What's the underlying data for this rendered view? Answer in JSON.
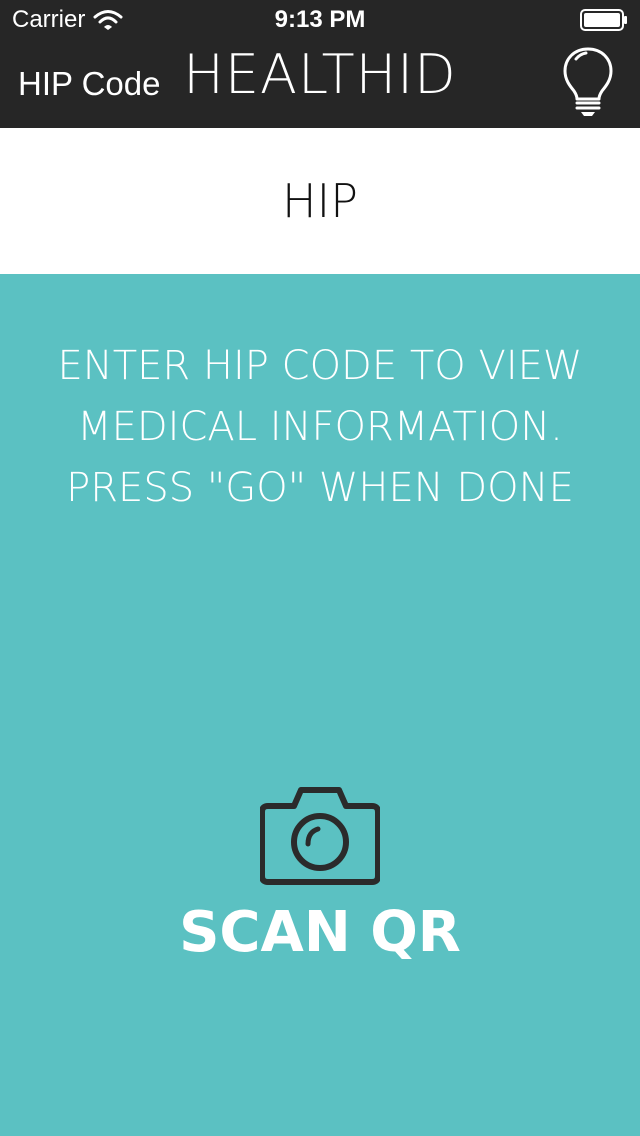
{
  "status_bar": {
    "carrier": "Carrier",
    "time": "9:13 PM",
    "wifi_icon": "wifi-icon",
    "battery_icon": "battery-icon"
  },
  "nav": {
    "back_label": "HIP Code",
    "title": "HEALTHID",
    "right_icon": "lightbulb-icon"
  },
  "hip_field": {
    "placeholder": "HIP",
    "value": ""
  },
  "instructions": "ENTER HIP CODE TO VIEW MEDICAL INFORMATION. PRESS \"GO\" WHEN DONE",
  "scan": {
    "icon": "camera-icon",
    "label": "SCAN QR"
  },
  "colors": {
    "nav_background": "#262626",
    "content_background": "#5bc1c2",
    "input_background": "#ffffff",
    "text_on_teal": "#ffffff",
    "icon_dark": "#2b2b2b"
  }
}
